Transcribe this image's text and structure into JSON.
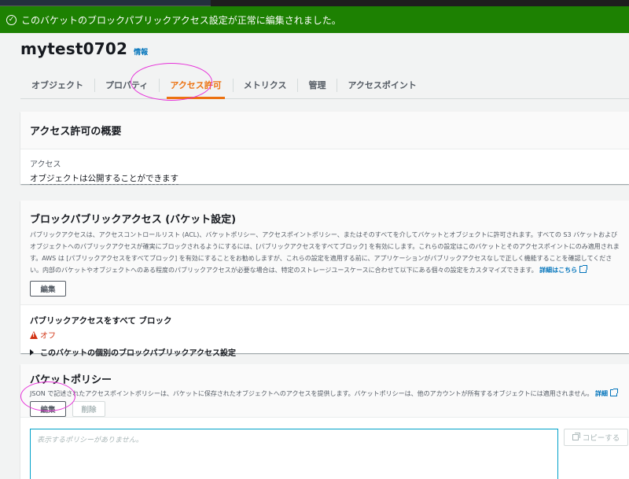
{
  "flash": {
    "icon": "success-check-icon",
    "message": "このバケットのブロックパブリックアクセス設定が正常に編集されました。"
  },
  "bucket": {
    "name": "mytest0702",
    "info_link": "情報"
  },
  "tabs": [
    {
      "label": "オブジェクト"
    },
    {
      "label": "プロパティ"
    },
    {
      "label": "アクセス許可"
    },
    {
      "label": "メトリクス"
    },
    {
      "label": "管理"
    },
    {
      "label": "アクセスポイント"
    }
  ],
  "overview": {
    "title": "アクセス許可の概要",
    "access_label": "アクセス",
    "access_value": "オブジェクトは公開することができます"
  },
  "block_public_access": {
    "title": "ブロックパブリックアクセス (バケット設定)",
    "desc1": "パブリックアクセスは、アクセスコントロールリスト (ACL)、バケットポリシー、アクセスポイントポリシー、またはそのすべてを介してバケットとオブジェクトに許可されます。すべての S3 バケットおよびオブジェクトへのパブリックアクセスが確実にブロックされるようにするには、[パブリックアクセスをすべてブロック] を有効にします。これらの設定はこのバケットとそのアクセスポイントにのみ適用されます。AWS は [パブリックアクセスをすべてブロック] を有効にすることをお勧めしますが、これらの設定を適用する前に、アプリケーションがパブリックアクセスなしで正しく機能することを確認してください。内部のバケットやオブジェクトへのある程度のパブリックアクセスが必要な場合は、特定のストレージユースケースに合わせて以下にある個々の設定をカスタマイズできます。",
    "learn_more": "詳細はこちら",
    "edit_button": "編集",
    "block_all_label": "パブリックアクセスをすべて ブロック",
    "block_all_status": "オフ",
    "expander_label": "このバケットの個別のブロックパブリックアクセス設定",
    "status_color": "#d13212"
  },
  "bucket_policy": {
    "title": "バケットポリシー",
    "desc": "JSON で記述されたアクセスポイントポリシーは、バケットに保存されたオブジェクトへのアクセスを提供します。バケットポリシーは、他のアカウントが所有するオブジェクトには適用されません。",
    "learn_more": "詳細",
    "edit_button": "編集",
    "delete_button": "削除",
    "editor_placeholder": "表示するポリシーがありません。",
    "copy_button": "コピーする"
  },
  "colors": {
    "accent": "#ec7211",
    "success": "#1d8102",
    "link": "#0073bb",
    "annotation": "#e630d9"
  }
}
